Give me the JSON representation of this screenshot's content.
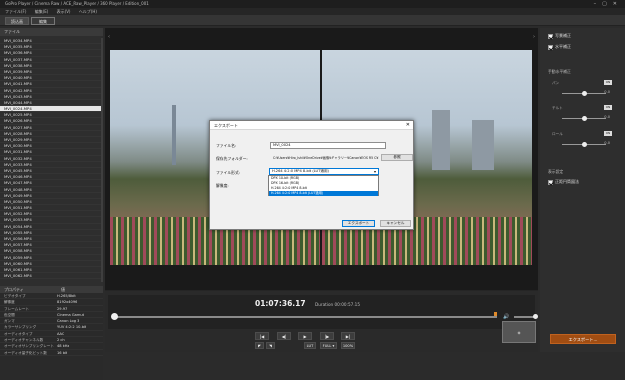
{
  "window": {
    "title": "GoPro Player / Cinema Raw / ACE_Raw_Player / 360 Player / Edition_001"
  },
  "menu": [
    "ファイル(F)",
    "編集(E)",
    "表示(V)",
    "ヘルプ(H)"
  ],
  "modes": [
    {
      "label": "読込画"
    },
    {
      "label": "編集"
    }
  ],
  "files": {
    "header": "ファイル",
    "items": [
      "MVI_0034.MP4",
      "MVI_0035.MP4",
      "MVI_0036.MP4",
      "MVI_0037.MP4",
      "MVI_0038.MP4",
      "MVI_0039.MP4",
      "MVI_0040.MP4",
      "MVI_0041.MP4",
      "MVI_0042.MP4",
      "MVI_0043.MP4",
      "MVI_0044.MP4",
      "MVI_0024.MP4",
      "MVI_0025.MP4",
      "MVI_0026.MP4",
      "MVI_0027.MP4",
      "MVI_0028.MP4",
      "MVI_0029.MP4",
      "MVI_0030.MP4",
      "MVI_0031.MP4",
      "MVI_0032.MP4",
      "MVI_0033.MP4",
      "MVI_0045.MP4",
      "MVI_0046.MP4",
      "MVI_0047.MP4",
      "MVI_0048.MP4",
      "MVI_0049.MP4",
      "MVI_0050.MP4",
      "MVI_0051.MP4",
      "MVI_0052.MP4",
      "MVI_0053.MP4",
      "MVI_0054.MP4",
      "MVI_0055.MP4",
      "MVI_0056.MP4",
      "MVI_0057.MP4",
      "MVI_0058.MP4",
      "MVI_0059.MP4",
      "MVI_0060.MP4",
      "MVI_0061.MP4",
      "MVI_0062.MP4"
    ],
    "selected_index": 11
  },
  "properties": {
    "header_key": "プロパティ",
    "header_val": "値",
    "rows": [
      {
        "k": "ビデオタイプ",
        "v": "H.265/8bit"
      },
      {
        "k": "解像度",
        "v": "8192x4096"
      },
      {
        "k": "フレームレート",
        "v": "29.97"
      },
      {
        "k": "色空間",
        "v": "Cinema Gamut"
      },
      {
        "k": "ガンマ",
        "v": "Canon Log 3"
      },
      {
        "k": "カラーサンプリング",
        "v": "YUV 4:2:2 10-bit"
      },
      {
        "k": "オーディオタイプ",
        "v": "AAC"
      },
      {
        "k": "オーディオチャンネル数",
        "v": "2 ch"
      },
      {
        "k": "オーディオサンプリングレート",
        "v": "48 kHz"
      },
      {
        "k": "オーディオ量子化ビット数",
        "v": "16 bit"
      }
    ]
  },
  "player": {
    "timecode": "01:07:36.17",
    "duration": "Duration 00:00:57.15",
    "progress": 0.0,
    "volume": 0.85,
    "controls": {
      "prev": "|◀",
      "step_back": "◀|",
      "play": "▶",
      "step_fwd": "|▶",
      "next": "▶|",
      "mark_in": "◤",
      "mark_out": "◥",
      "lut": "LUT",
      "full": "FULL ▾",
      "zoom": "100%"
    },
    "preview_label": "◈"
  },
  "right_panel": {
    "check1": "写景補正",
    "check2": "水平補正",
    "section1": "手動水平補正",
    "sliders": [
      {
        "label": "パン",
        "value": "0.0",
        "toggle": "ON"
      },
      {
        "label": "チルト",
        "value": "0.0",
        "toggle": "ON"
      },
      {
        "label": "ロール",
        "value": "0.0",
        "toggle": "ON"
      }
    ],
    "section2": "表示設定",
    "check3": "正距円筒図法",
    "export": "エクスポート..."
  },
  "dialog": {
    "title": "エクスポート",
    "filename_label": "ファイル名:",
    "filename_value": "MVI_0024",
    "folder_label": "保存先フォルダー:",
    "folder_value": "C:¥Users¥Hiro_Ishii¥OneDrive¥画像¥ギャラリー¥Canon¥EOS R5 C¥",
    "browse": "参照",
    "format_label": "ファイル形式:",
    "format_value": "H.264 4:2:0 MP4 8-bit (LUT適用)",
    "format_options": [
      "DPX 10-bit (RGB)",
      "DPX 16-bit (RGB)",
      "H.264 4:2:0 MP4 8-bit",
      "H.264 4:2:0 MP4 8-bit (LUT適用)"
    ],
    "highlight_index": 3,
    "resolution_label": "解像度:",
    "export_btn": "エクスポート",
    "cancel_btn": "キャンセル"
  },
  "colors": {
    "accent": "#a14d12",
    "selection": "#0078d7",
    "background": "#2b2b2b"
  }
}
